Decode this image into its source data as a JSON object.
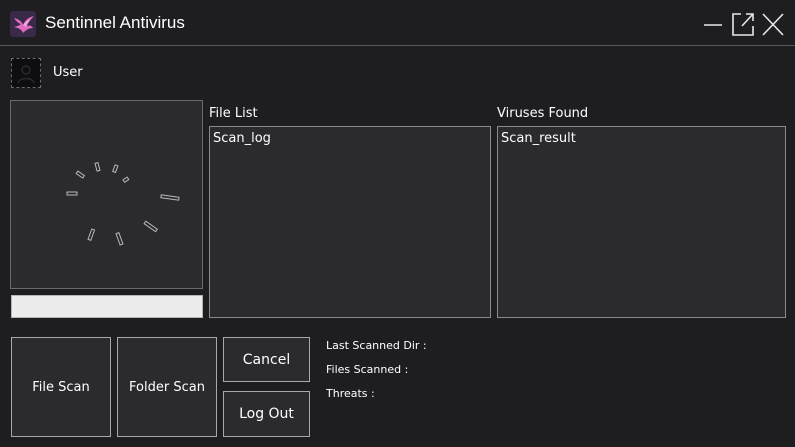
{
  "window": {
    "title": "Sentinnel Antivirus",
    "icons": {
      "app": "bird-logo-icon",
      "minimize": "minimize-icon",
      "maximize": "maximize-icon",
      "close": "close-icon"
    }
  },
  "user": {
    "name": "User",
    "avatar_icon": "user-avatar-icon"
  },
  "scan": {
    "progress_percent": 0
  },
  "file_list": {
    "label": "File List",
    "items": [
      "Scan_log"
    ]
  },
  "viruses_found": {
    "label": "Viruses Found",
    "items": [
      "Scan_result"
    ]
  },
  "buttons": {
    "file_scan": "File Scan",
    "folder_scan": "Folder Scan",
    "cancel": "Cancel",
    "log_out": "Log Out"
  },
  "stats": {
    "last_scanned_dir": "Last Scanned Dir :",
    "files_scanned": "Files Scanned :",
    "threats": "Threats :"
  },
  "colors": {
    "background": "#1e1e21",
    "panel": "#2b2b2f",
    "border": "#8a8a8e",
    "logo_pink": "#e06cc0",
    "logo_purple": "#6b3fa0"
  }
}
